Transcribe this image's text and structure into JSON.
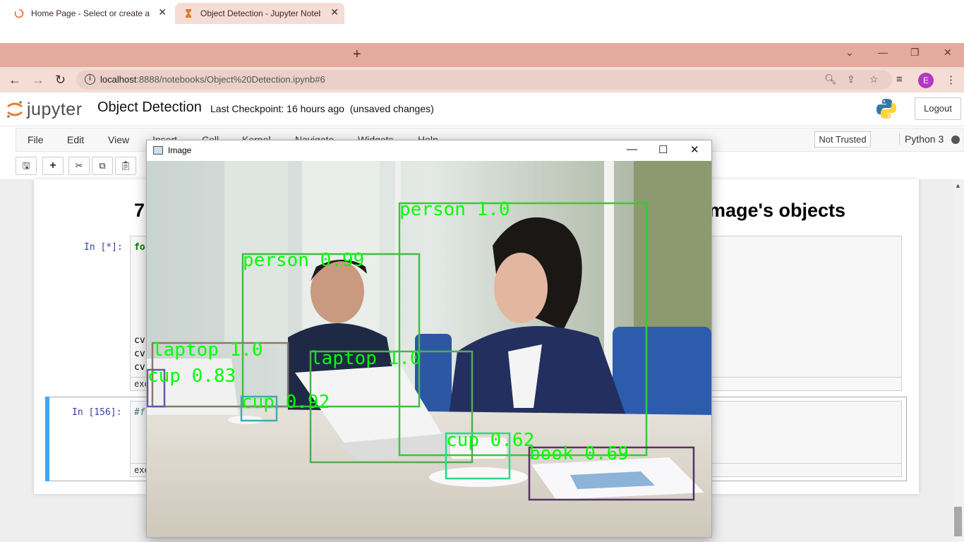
{
  "browser": {
    "tabs": [
      {
        "title": "Home Page - Select or create a notebook",
        "close": "✕"
      },
      {
        "title": "Object Detection - Jupyter Notebook",
        "close": "✕"
      }
    ],
    "new_tab": "+",
    "url_host": "localhost",
    "url_rest": ":8888/notebooks/Object%20Detection.ipynb#6",
    "avatar_letter": "E",
    "accent_color": "#e4aa9d"
  },
  "jupyter": {
    "logo_text": "jupyter",
    "notebook_title": "Object Detection",
    "checkpoint": "Last Checkpoint: 16 hours ago",
    "unsaved": "(unsaved changes)",
    "logout": "Logout",
    "menus": [
      "File",
      "Edit",
      "View",
      "Insert",
      "Cell",
      "Kernel",
      "Navigate",
      "Widgets",
      "Help"
    ],
    "not_trusted": "Not Trusted",
    "kernel": "Python 3"
  },
  "notebook": {
    "heading_left": "7",
    "heading_right": "mage's objects",
    "cell1_prompt": "In [*]:",
    "cell1_code": "fo",
    "cell1_lines": [
      "cv",
      "cv",
      "cv"
    ],
    "cell1_footer": "exe",
    "cell2_prompt": "In [156]:",
    "cell2_code": "#f",
    "cell2_footer": "exe"
  },
  "image_window": {
    "title": "Image",
    "detections": [
      {
        "label": "person 1.0",
        "color": "#33cc33"
      },
      {
        "label": "person 0.99",
        "color": "#33bb33"
      },
      {
        "label": "laptop 1.0",
        "color": "#8a7a6a"
      },
      {
        "label": "laptop 1.0",
        "color": "#55aa55"
      },
      {
        "label": "cup 0.83",
        "color": "#6a55aa"
      },
      {
        "label": "cup 0.92",
        "color": "#44aaaa"
      },
      {
        "label": "cup 0.62",
        "color": "#22dd88"
      },
      {
        "label": "book 0.69",
        "color": "#553366"
      }
    ]
  }
}
